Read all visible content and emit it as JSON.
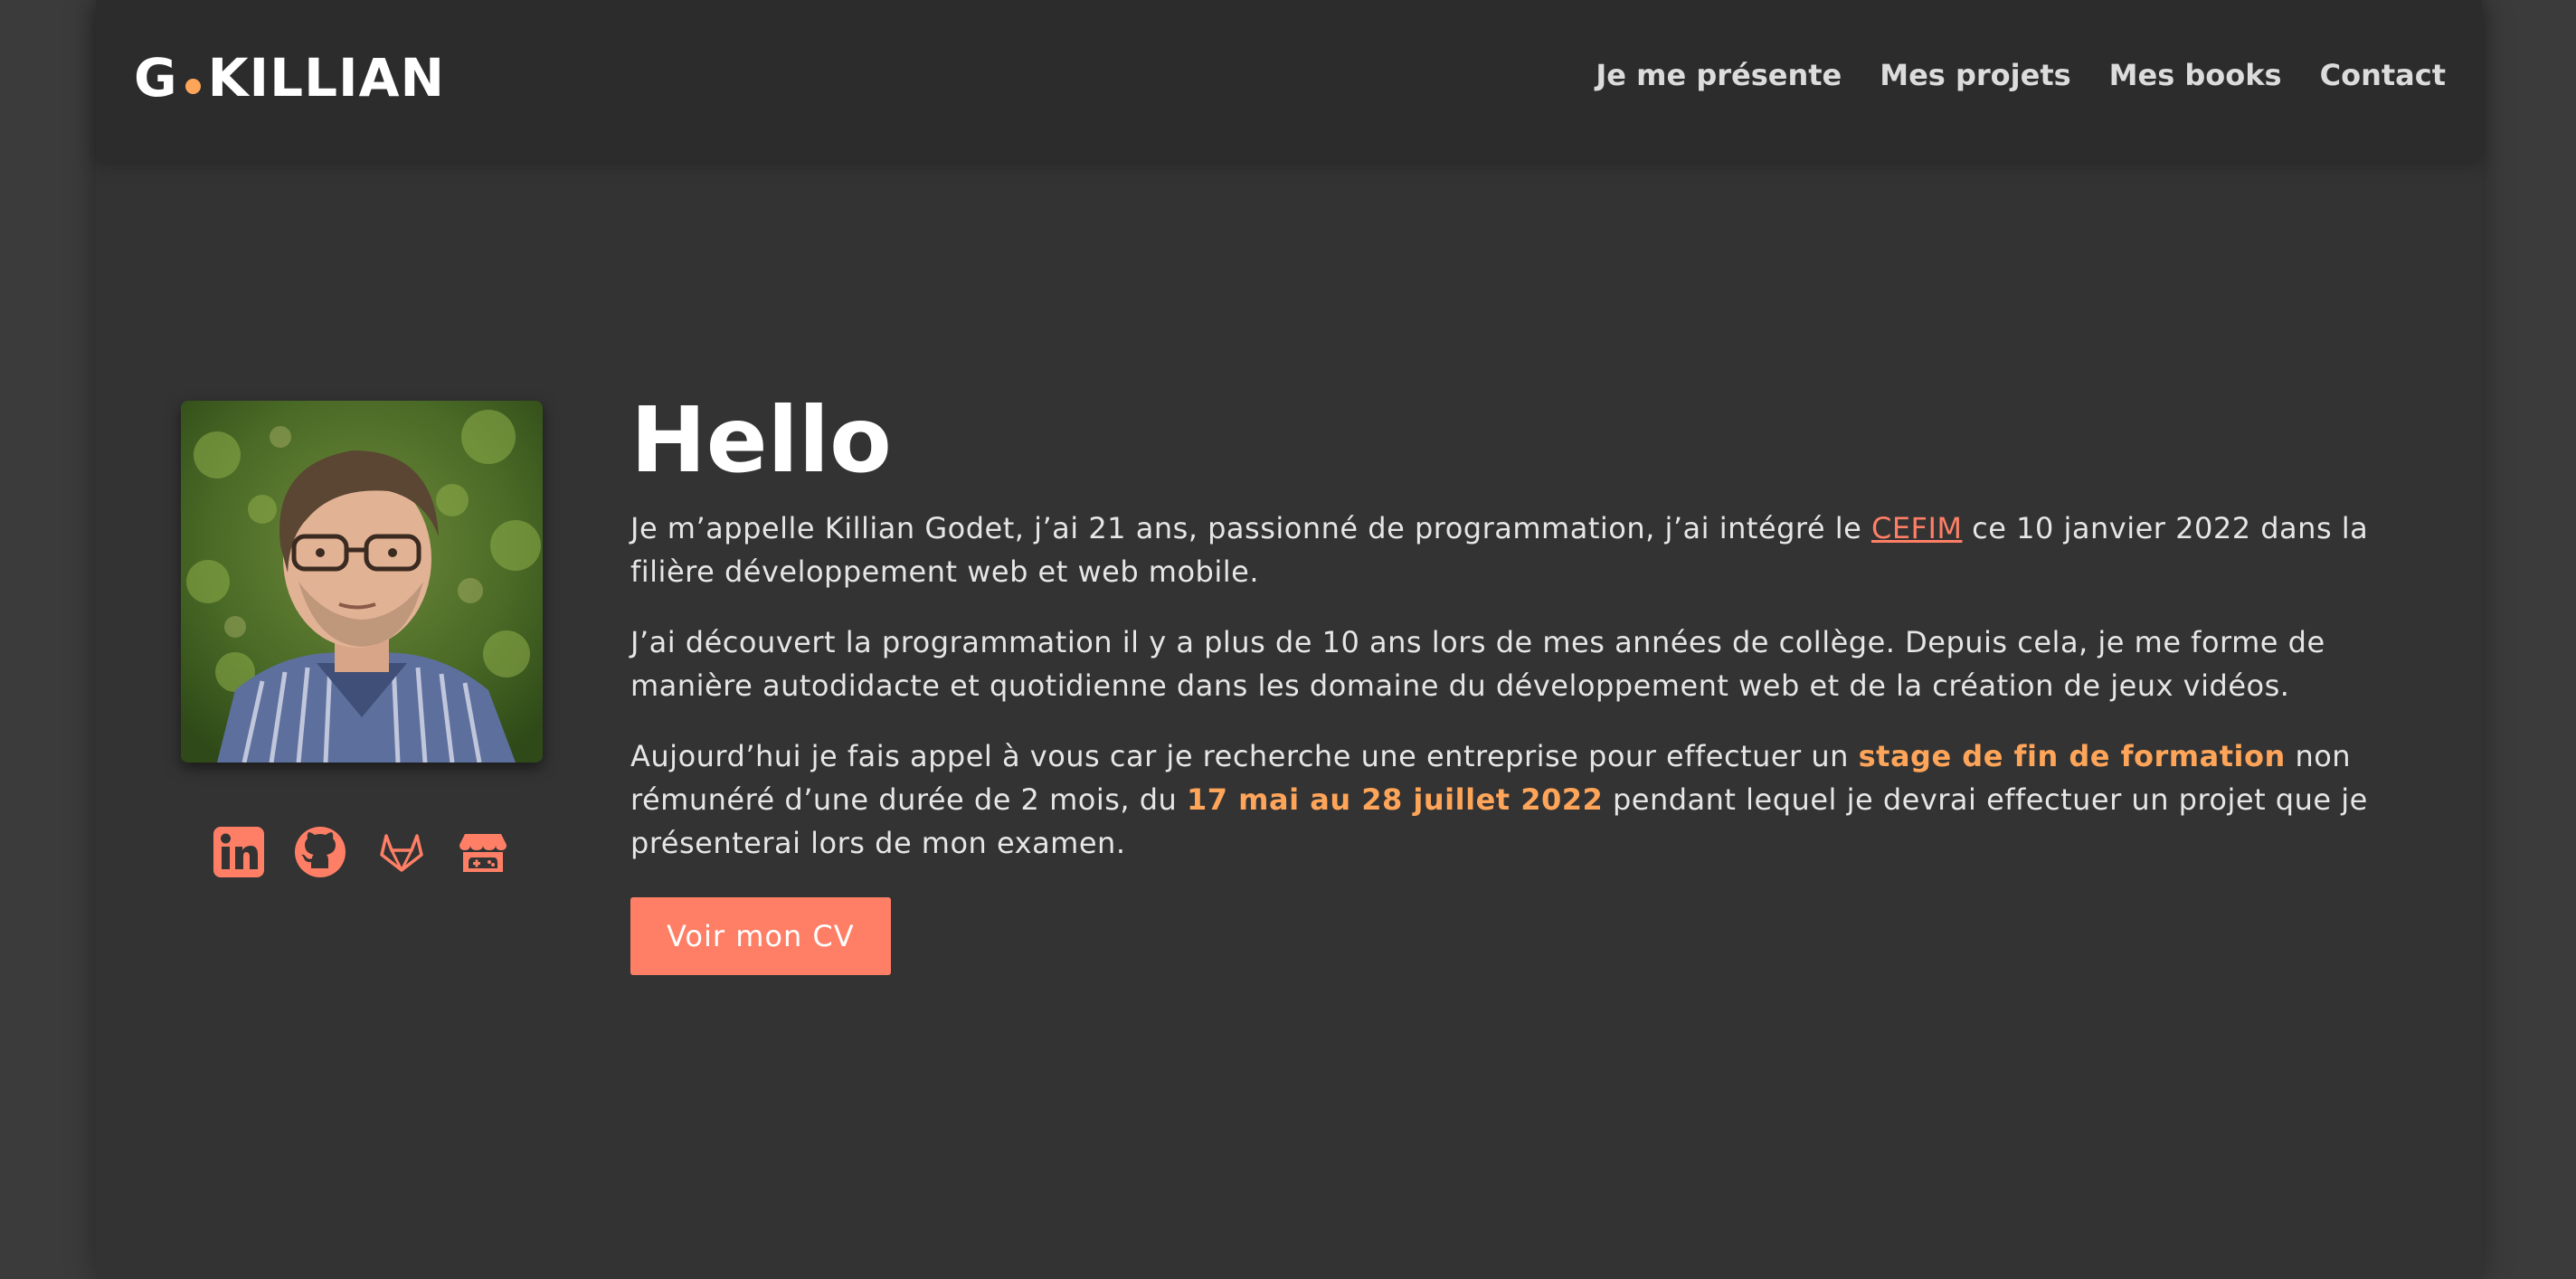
{
  "brand": {
    "left": "G",
    "right": "KILLIAN",
    "dot_color": "#ffa559"
  },
  "nav": [
    {
      "label": "Je me présente"
    },
    {
      "label": "Mes projets"
    },
    {
      "label": "Mes books"
    },
    {
      "label": "Contact"
    }
  ],
  "hero": {
    "title": "Hello",
    "p1_a": "Je m’appelle Killian Godet, j’ai 21 ans, passionné de programmation, j’ai intégré le ",
    "p1_link": "CEFIM",
    "p1_b": " ce 10 janvier 2022 dans la filière développement web et web mobile.",
    "p2": "J’ai découvert la programmation il y a plus de 10 ans lors de mes années de collège. Depuis cela, je me forme de manière autodidacte et quotidienne dans les domaine du développement web et de la création de jeux vidéos.",
    "p3_a": "Aujourd’hui je fais appel à vous car je recherche une entreprise pour effectuer un ",
    "p3_hl1": "stage de fin de formation",
    "p3_b": " non rémunéré d’une durée de 2 mois, du ",
    "p3_hl2": "17 mai au 28 juillet 2022",
    "p3_c": " pendant lequel je devrai effectuer un projet que je présenterai lors de mon examen.",
    "cta": "Voir mon CV"
  },
  "socials": [
    {
      "icon": "linkedin-icon"
    },
    {
      "icon": "github-icon"
    },
    {
      "icon": "gitlab-icon"
    },
    {
      "icon": "itchio-icon"
    }
  ],
  "colors": {
    "accent": "#ff7f66",
    "highlight": "#ffa559",
    "background": "#333333",
    "navbar": "#2c2c2c"
  }
}
